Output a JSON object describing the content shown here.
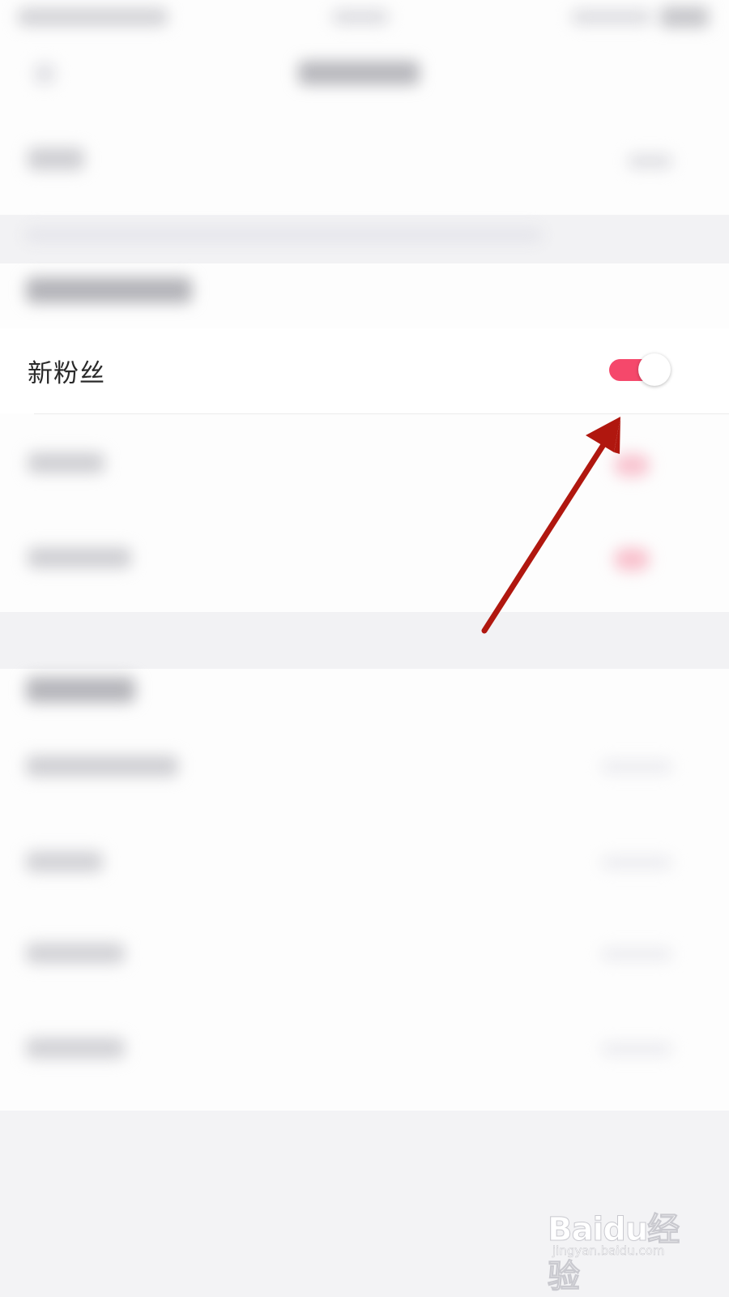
{
  "settings_row": {
    "label": "新粉丝",
    "toggle_on": true
  },
  "colors": {
    "toggle_track": "#f5486b",
    "arrow": "#b0170f"
  },
  "watermark": {
    "logo": "Baidu经验",
    "url": "jingyan.baidu.com"
  }
}
